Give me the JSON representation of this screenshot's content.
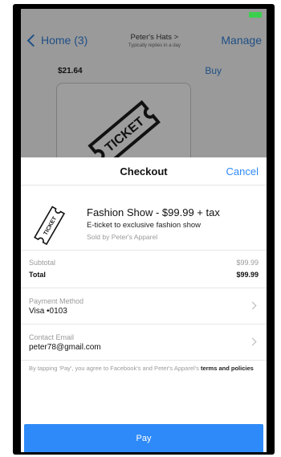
{
  "background": {
    "nav": {
      "back_label": "Home (3)",
      "title": "Peter's Hats >",
      "subtitle": "Typically replies in a day",
      "manage_label": "Manage"
    },
    "product_price": "$21.64",
    "buy_label": "Buy",
    "ticket_image_text": "TICKET"
  },
  "checkout": {
    "title": "Checkout",
    "cancel_label": "Cancel",
    "product": {
      "name": "Fashion Show - $99.99 + tax",
      "description": "E-ticket to exclusive fashion show",
      "seller": "Sold by Peter's Apparel",
      "ticket_image_text": "TICKET"
    },
    "subtotal_label": "Subtotal",
    "subtotal_value": "$99.99",
    "total_label": "Total",
    "total_value": "$99.99",
    "payment_method_label": "Payment Method",
    "payment_method_value": "Visa •0103",
    "contact_email_label": "Contact Email",
    "contact_email_value": "peter78@gmail.com",
    "terms_prefix": "By tapping 'Pay', you agree to Facebook's and Peter's Apparel's ",
    "terms_link": "terms and policies",
    "pay_label": "Pay"
  },
  "colors": {
    "accent": "#2e8af8",
    "battery": "#3ccf4e"
  },
  "icons": {
    "back": "chevron-left-icon",
    "row_chevron": "chevron-right-icon",
    "ticket": "ticket-icon"
  }
}
